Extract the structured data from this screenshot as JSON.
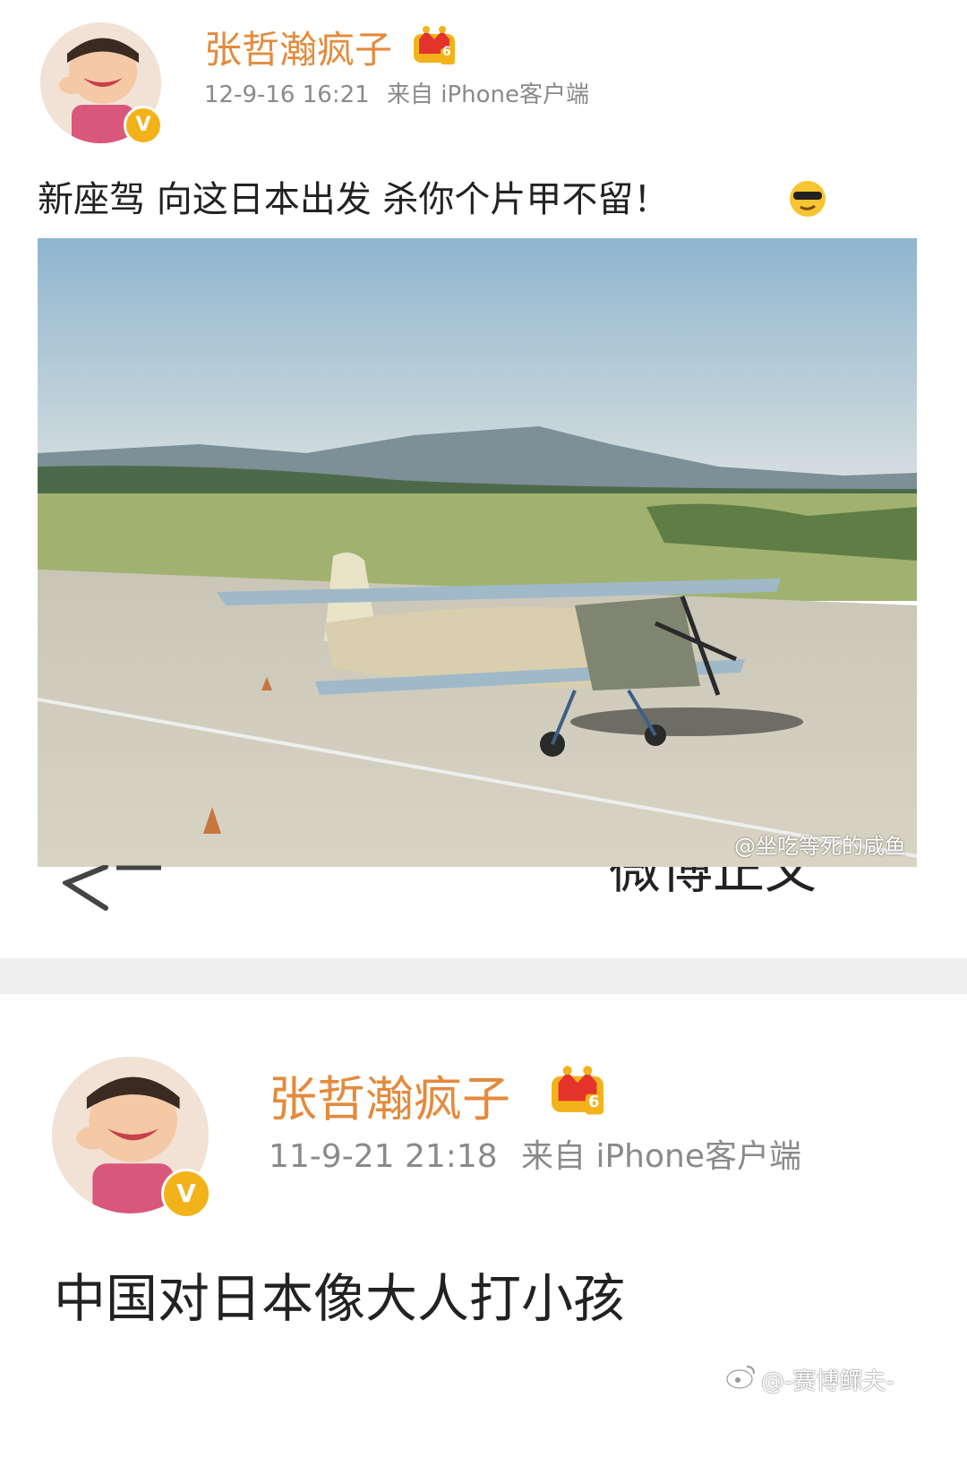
{
  "posts": [
    {
      "username": "张哲瀚疯子",
      "timestamp": "12-9-16 16:21",
      "source": "来自 iPhone客户端",
      "text": "新座驾 向这日本出发 杀你个片甲不留！",
      "emoji_icon": "cool-sunglasses-emoji",
      "image_watermark": "@坐吃等死的咸鱼",
      "vip_level": "6"
    },
    {
      "username": "张哲瀚疯子",
      "timestamp": "11-9-21 21:18",
      "source": "来自 iPhone客户端",
      "text": "中国对日本像大人打小孩",
      "vip_level": "6"
    }
  ],
  "nav": {
    "back_icon": "chevron-left-icon",
    "title_partial": "微博正文"
  },
  "footer_watermark": "@-赛博鳏夫-",
  "colors": {
    "username": "#e48a3c",
    "meta": "#8a8a8a",
    "badge": "#f2b21a",
    "divider": "#eeeeee"
  }
}
